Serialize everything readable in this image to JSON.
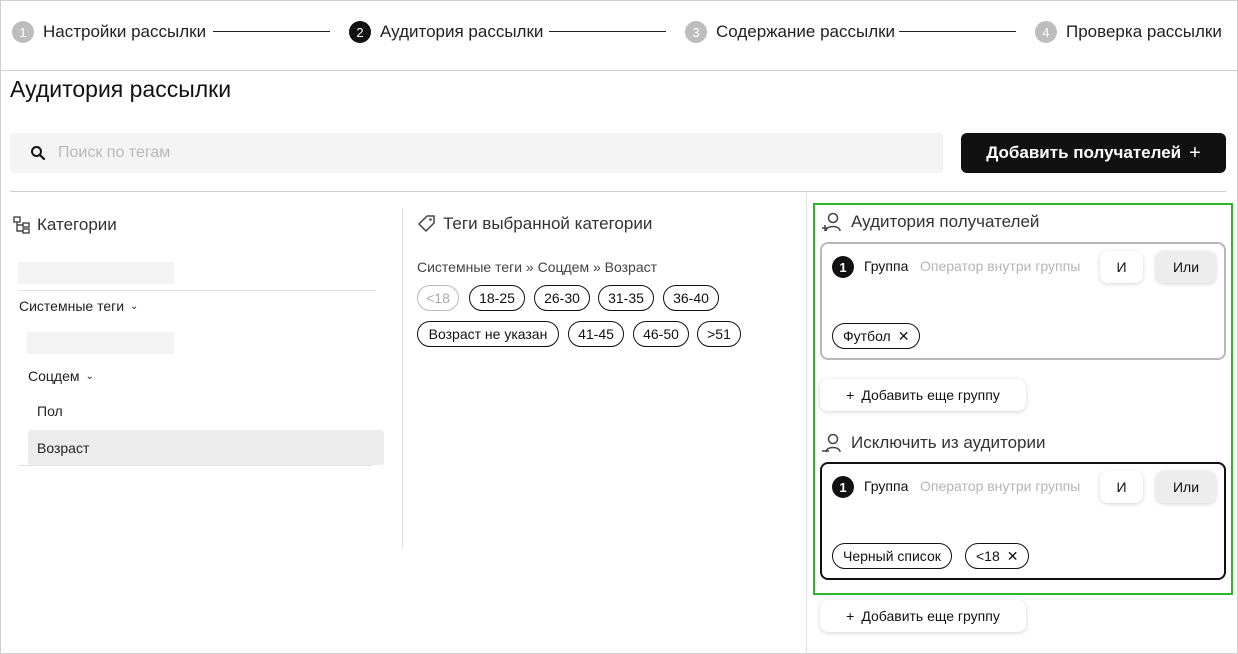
{
  "stepper": {
    "steps": [
      {
        "num": "1",
        "label": "Настройки рассылки"
      },
      {
        "num": "2",
        "label": "Аудитория рассылки"
      },
      {
        "num": "3",
        "label": "Содержание рассылки"
      },
      {
        "num": "4",
        "label": "Проверка рассылки"
      }
    ],
    "active_step": 2
  },
  "page_title": "Аудитория рассылки",
  "search": {
    "placeholder": "Поиск по тегам"
  },
  "add_recipients": {
    "label": "Добавить получателей",
    "icon": "+"
  },
  "categories": {
    "title": "Категории",
    "system_tags": "Системные теги",
    "socdem": "Соцдем",
    "items": [
      "Пол",
      "Возраст"
    ],
    "selected": "Возраст"
  },
  "tags": {
    "title": "Теги выбранной категории",
    "breadcrumb": "Системные теги » Соцдем » Возраст",
    "row1": [
      "<18",
      "18-25",
      "26-30",
      "31-35",
      "36-40"
    ],
    "row2": [
      "Возраст не указан",
      "41-45",
      "46-50",
      ">51"
    ]
  },
  "audience": {
    "title": "Аудитория получателей",
    "group": {
      "num": "1",
      "label": "Группа",
      "operator_label": "Оператор внутри группы",
      "and_label": "И",
      "or_label": "Или",
      "chips": [
        "Футбол"
      ]
    },
    "add_group_label": "Добавить еще группу"
  },
  "exclude": {
    "title": "Исключить из аудитории",
    "group": {
      "num": "1",
      "label": "Группа",
      "operator_label": "Оператор внутри группы",
      "and_label": "И",
      "or_label": "Или",
      "chips": [
        "Черный список",
        "<18"
      ]
    },
    "add_group_label": "Добавить еще группу"
  },
  "colors": {
    "accent_border": "#2db52d",
    "primary": "#111111"
  }
}
